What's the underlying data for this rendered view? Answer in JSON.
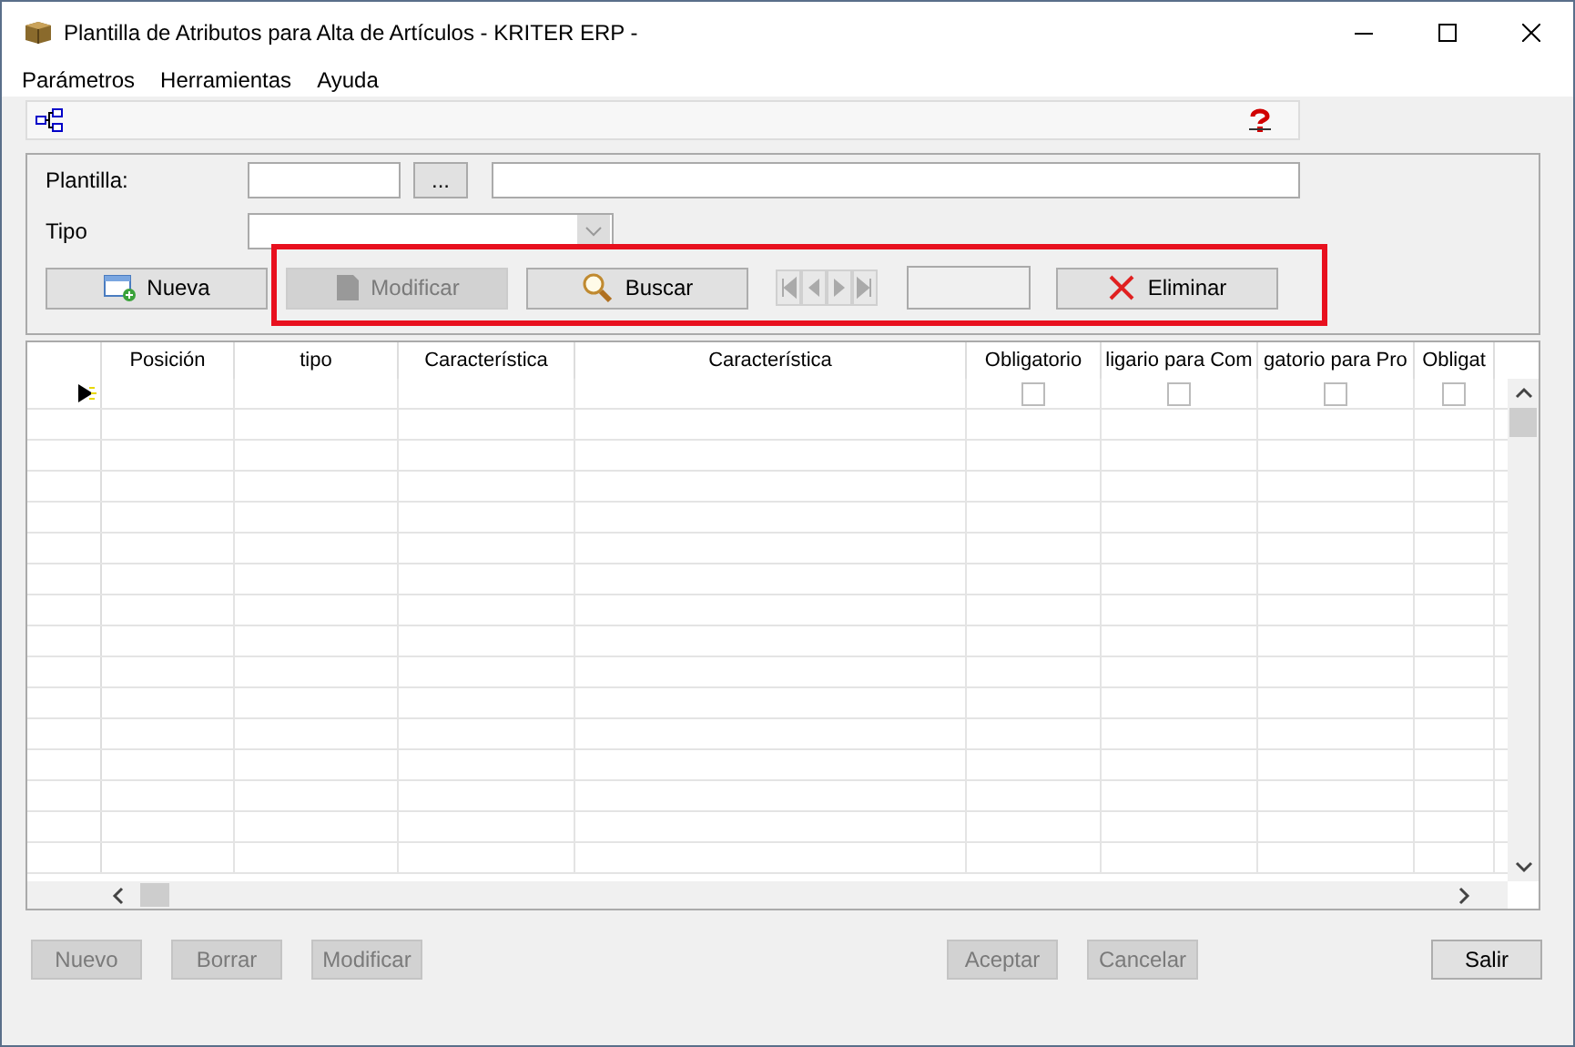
{
  "window": {
    "title": "Plantilla de Atributos para Alta de Artículos - KRITER ERP -"
  },
  "menu": [
    "Parámetros",
    "Herramientas",
    "Ayuda"
  ],
  "form": {
    "plantilla": {
      "label": "Plantilla:",
      "browse": "..."
    },
    "tipo": {
      "label": "Tipo"
    }
  },
  "actions": [
    {
      "kind": "new",
      "label": "Nueva",
      "disabled": false
    },
    {
      "kind": "edit",
      "label": "Modificar",
      "disabled": true
    },
    {
      "kind": "search",
      "label": "Buscar",
      "disabled": false
    },
    {
      "kind": "navigator",
      "disabled": true
    },
    {
      "kind": "field"
    },
    {
      "kind": "delete",
      "label": "Eliminar",
      "disabled": false
    }
  ],
  "grid": {
    "columns": [
      {
        "label": "Posición"
      },
      {
        "label": "tipo"
      },
      {
        "label": "Característica"
      },
      {
        "label": "Característica"
      },
      {
        "label": "Obligatorio",
        "checked": false
      },
      {
        "label": "ligario para Com",
        "checked": false
      },
      {
        "label": "gatorio para Pro",
        "checked": false
      },
      {
        "label": "Obligat",
        "checked": false
      }
    ]
  },
  "footer": {
    "record_buttons": [
      {
        "label": "Nuevo",
        "disabled": true
      },
      {
        "label": "Borrar",
        "disabled": true
      },
      {
        "label": "Modificar",
        "disabled": true
      }
    ],
    "edit_buttons": [
      {
        "label": "Aceptar",
        "disabled": true
      },
      {
        "label": "Cancelar",
        "disabled": true
      }
    ],
    "exit_buttons": [
      {
        "label": "Salir",
        "disabled": false
      }
    ]
  }
}
